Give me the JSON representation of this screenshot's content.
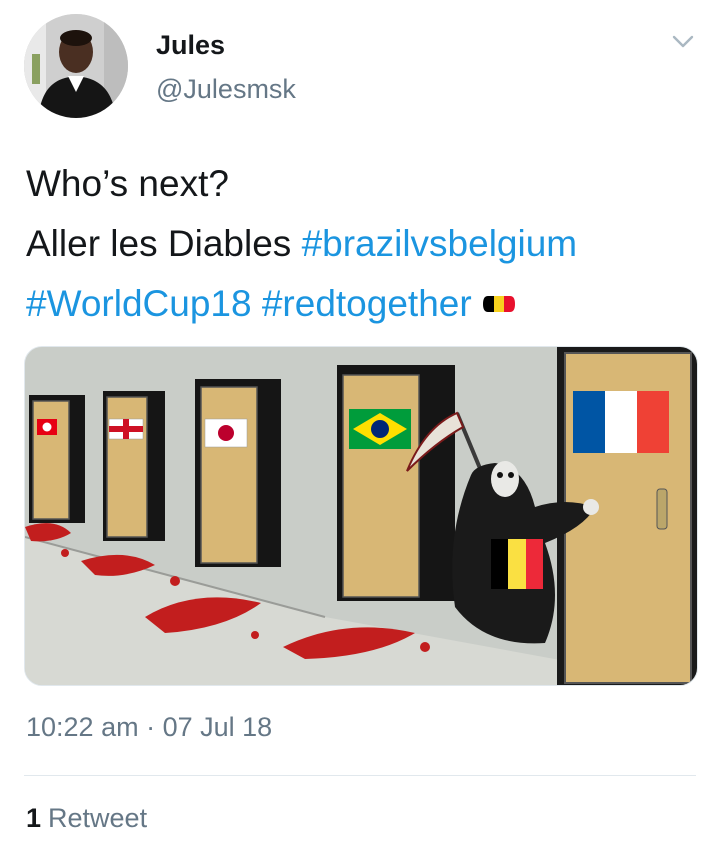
{
  "user": {
    "name": "Jules",
    "handle": "@Julesmsk"
  },
  "icons": {
    "menu": "chevron-down-icon",
    "emoji": "belgium-flag-emoji"
  },
  "tweet": {
    "line1": "Who’s next?",
    "line2_text": "Aller les Diables ",
    "hashtags": [
      "#brazilvsbelgium",
      "#WorldCup18",
      "#redtogether"
    ]
  },
  "media": {
    "description_only": false
  },
  "meta": {
    "time": "10:22 am",
    "separator": " · ",
    "date": "07 Jul 18"
  },
  "stats": {
    "retweet_count": "1",
    "retweet_label": "Retweet"
  },
  "colors": {
    "hashtag": "#1b95e0",
    "secondary_text": "#657786",
    "divider": "#e1e8ed"
  }
}
